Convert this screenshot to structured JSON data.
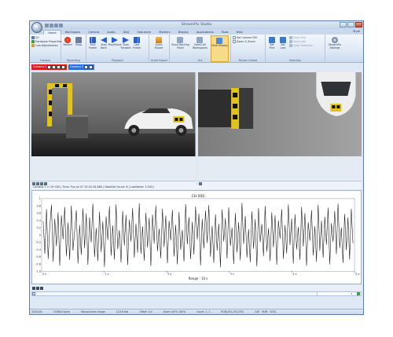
{
  "window": {
    "title": "StreamPix Studio"
  },
  "ribbon_tabs": [
    "Home",
    "Workspace",
    "Camera",
    "Audio",
    "DAQ",
    "Sequence",
    "Markers",
    "Display",
    "Applications",
    "Tools",
    "Help"
  ],
  "style_label": "Style",
  "camera_group": {
    "label": "Camera",
    "items": [
      "I/O",
      "Hardware Properties",
      "Live Adjustments"
    ]
  },
  "recording_group": {
    "label": "Recording",
    "buttons": [
      "Record",
      "Snap"
    ]
  },
  "playback_group": {
    "label": "Playback",
    "buttons": [
      "First Frame",
      "Step Back",
      "Play/Pause",
      "Step Forward",
      "Last Frame"
    ]
  },
  "quick_export_group": {
    "label": "Quick Export",
    "buttons": [
      "Quick Export"
    ]
  },
  "gui_group": {
    "label": "GUI",
    "buttons": [
      "Show Docking Panel",
      "Select All Workspaces",
      "Multi Display"
    ]
  },
  "mouse_control_group": {
    "label": "Mouse Control",
    "items": [
      "Set Camera ROI",
      "Zoom & Zoom"
    ]
  },
  "selection_group": {
    "label": "Selection",
    "buttons": [
      "Set First",
      "Set Last"
    ],
    "items": [
      "Goto First",
      "Goto Last",
      "Clear Selection"
    ]
  },
  "settings_group": {
    "buttons": [
      "StreamPix Settings"
    ]
  },
  "camera_tabs": [
    "Camera 1",
    "Camera 2"
  ],
  "info_line": "Camera 1 > CH 000 | Time: Tue Jul 07 15:31:34.860 | DataSet Count: 8 | LastValue: 3.543 |",
  "chart_data": {
    "type": "line",
    "title": "CH 000",
    "ylim": [
      -1,
      1
    ],
    "y_ticks": [
      "1",
      "0.8",
      "0.6",
      "0.4",
      "0.2",
      "0",
      "-0.2",
      "-0.4",
      "-0.6",
      "-0.8",
      "-1.0"
    ],
    "x_ticks": [
      "0 s",
      "1 s",
      "2 s",
      "3 s",
      "4 s",
      "5 s"
    ],
    "range_label": "Range : 10 s",
    "series": [
      {
        "values": [
          0.38,
          -0.52,
          0.71,
          -0.66,
          0.22,
          0.83,
          -0.74,
          0.45,
          -0.31,
          0.62,
          -0.85,
          0.54,
          -0.12,
          0.77,
          -0.58,
          0.34,
          -0.69,
          0.81,
          -0.43,
          0.11,
          0.68,
          -0.79,
          0.27,
          -0.55,
          0.73,
          -0.36,
          0.59,
          -0.82,
          0.48,
          -0.21,
          0.86,
          -0.61,
          0.19,
          -0.72,
          0.64,
          -0.47,
          0.37,
          -0.88,
          0.51,
          -0.14,
          0.79,
          -0.57,
          0.26,
          -0.68,
          0.84,
          -0.39,
          0.13,
          -0.76,
          0.66,
          -0.29,
          0.55,
          -0.83,
          0.42,
          -0.18,
          0.74,
          -0.63,
          0.31,
          -0.49,
          0.87,
          -0.52,
          0.23,
          -0.71,
          0.61,
          -0.35,
          0.47,
          -0.86,
          0.56,
          -0.24,
          0.81,
          -0.45,
          0.17,
          -0.64,
          0.72,
          -0.33,
          0.53,
          -0.78,
          0.39,
          -0.15,
          0.69,
          -0.59,
          0.28,
          -0.81,
          0.63,
          -0.41,
          0.14,
          -0.73,
          0.85,
          -0.26,
          0.49,
          -0.67,
          0.36,
          -0.54,
          0.78,
          -0.12,
          0.58,
          -0.84,
          0.44,
          -0.37,
          0.67,
          -0.22,
          0.82,
          -0.6,
          0.25,
          -0.77,
          0.57,
          -0.43,
          0.31,
          -0.89,
          0.7,
          -0.18,
          0.46,
          -0.65,
          0.76,
          -0.3,
          0.2,
          -0.8,
          0.6,
          -0.48,
          0.35,
          -0.7,
          0.88,
          -0.25,
          0.52,
          -0.62,
          0.16,
          -0.75,
          0.65,
          -0.38,
          0.43,
          -0.87,
          0.74,
          -0.2,
          0.3,
          -0.58,
          0.8,
          -0.46,
          0.18,
          -0.72,
          0.62,
          -0.34,
          0.54,
          -0.82,
          0.4,
          -0.1,
          0.71,
          -0.66,
          0.27,
          -0.51,
          0.84,
          -0.28,
          0.45,
          -0.79,
          0.57,
          -0.4,
          0.22,
          -0.69,
          0.77,
          -0.32,
          0.6,
          -0.85,
          0.35,
          -0.16,
          0.68,
          -0.56,
          0.24,
          -0.74,
          0.83,
          -0.44,
          0.39,
          -0.63,
          0.5,
          -0.27,
          0.75,
          -0.81,
          0.32,
          -0.19,
          0.66,
          -0.53,
          0.86,
          -0.36,
          0.21,
          -0.77,
          0.58,
          -0.42,
          0.48,
          -0.68,
          0.72,
          -0.23
        ]
      }
    ]
  },
  "statusbar": {
    "items": [
      "320x240",
      "153600 bytes",
      "Monochrome Image",
      "12/16 bits",
      "Offset: 0.0",
      "Zoom 100% 100%",
      "Count: 1, 1",
      "RGB(255,255,255)",
      "CAP",
      "NUM",
      "SCRL"
    ]
  },
  "colors": {
    "camera1_tab": "#d81f1f",
    "camera2_tab": "#2f6fd6",
    "ribbon_bg": "#dbe6f4"
  }
}
